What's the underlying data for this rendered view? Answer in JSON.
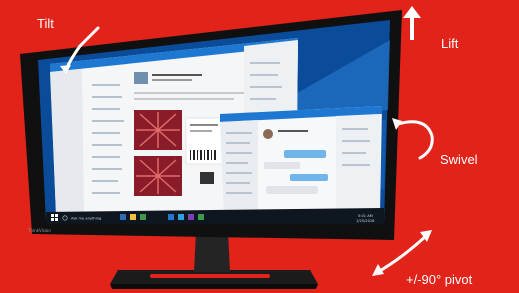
{
  "callouts": {
    "tilt": "Tilt",
    "lift": "Lift",
    "swivel": "Swivel",
    "pivot": "+/-90° pivot"
  },
  "monitor": {
    "brand": "ThinkVision"
  },
  "taskbar": {
    "search_placeholder": "Ask me anything",
    "clock": "5:01 AM",
    "date": "1/25/2016"
  },
  "colors": {
    "background": "#e2231a",
    "bezel": "#111111",
    "desktop": "#0b4c9a",
    "window_header": "#1e78d2",
    "arrow": "#ffffff"
  },
  "icons": [
    "curved-arrow-icon",
    "up-arrow-icon",
    "diagonal-double-arrow-icon",
    "windows-start-icon",
    "search-icon"
  ]
}
